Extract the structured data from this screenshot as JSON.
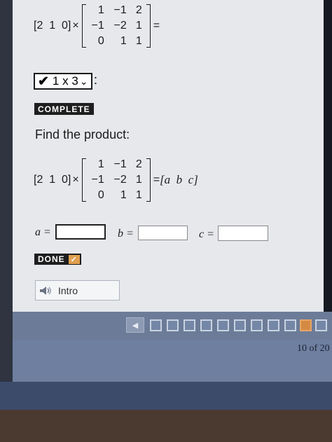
{
  "problem_preview": {
    "row_vector": "[2  1  0]",
    "times": "×",
    "matrix": [
      [
        "1",
        "−1",
        "2"
      ],
      [
        "−1",
        "−2",
        "1"
      ],
      [
        "0",
        "1",
        "1"
      ]
    ],
    "equals": "="
  },
  "size_dropdown": {
    "check": "✔",
    "value": "1 x 3",
    "caret": "⌄",
    "colon": ":"
  },
  "complete_badge": "COMPLETE",
  "prompt": "Find the product:",
  "problem": {
    "row_vector": "[2  1  0]",
    "times": "×",
    "matrix": [
      [
        "1",
        "−1",
        "2"
      ],
      [
        "−1",
        "−2",
        "1"
      ],
      [
        "0",
        "1",
        "1"
      ]
    ],
    "equals": "=",
    "result": "[a  b  c]"
  },
  "answers": [
    {
      "label": "a =",
      "value": ""
    },
    {
      "label": "b =",
      "value": ""
    },
    {
      "label": "c =",
      "value": ""
    }
  ],
  "done_badge": {
    "label": "DONE",
    "check": "✓"
  },
  "intro_button": {
    "label": "Intro",
    "icon": "speaker-icon"
  },
  "pagination": {
    "total_boxes": 11,
    "current_index": 9,
    "counter": "10 of 20"
  },
  "colors": {
    "accent": "#d58a44",
    "nav": "#6c7c98",
    "content_bg": "#e6e8ec"
  }
}
